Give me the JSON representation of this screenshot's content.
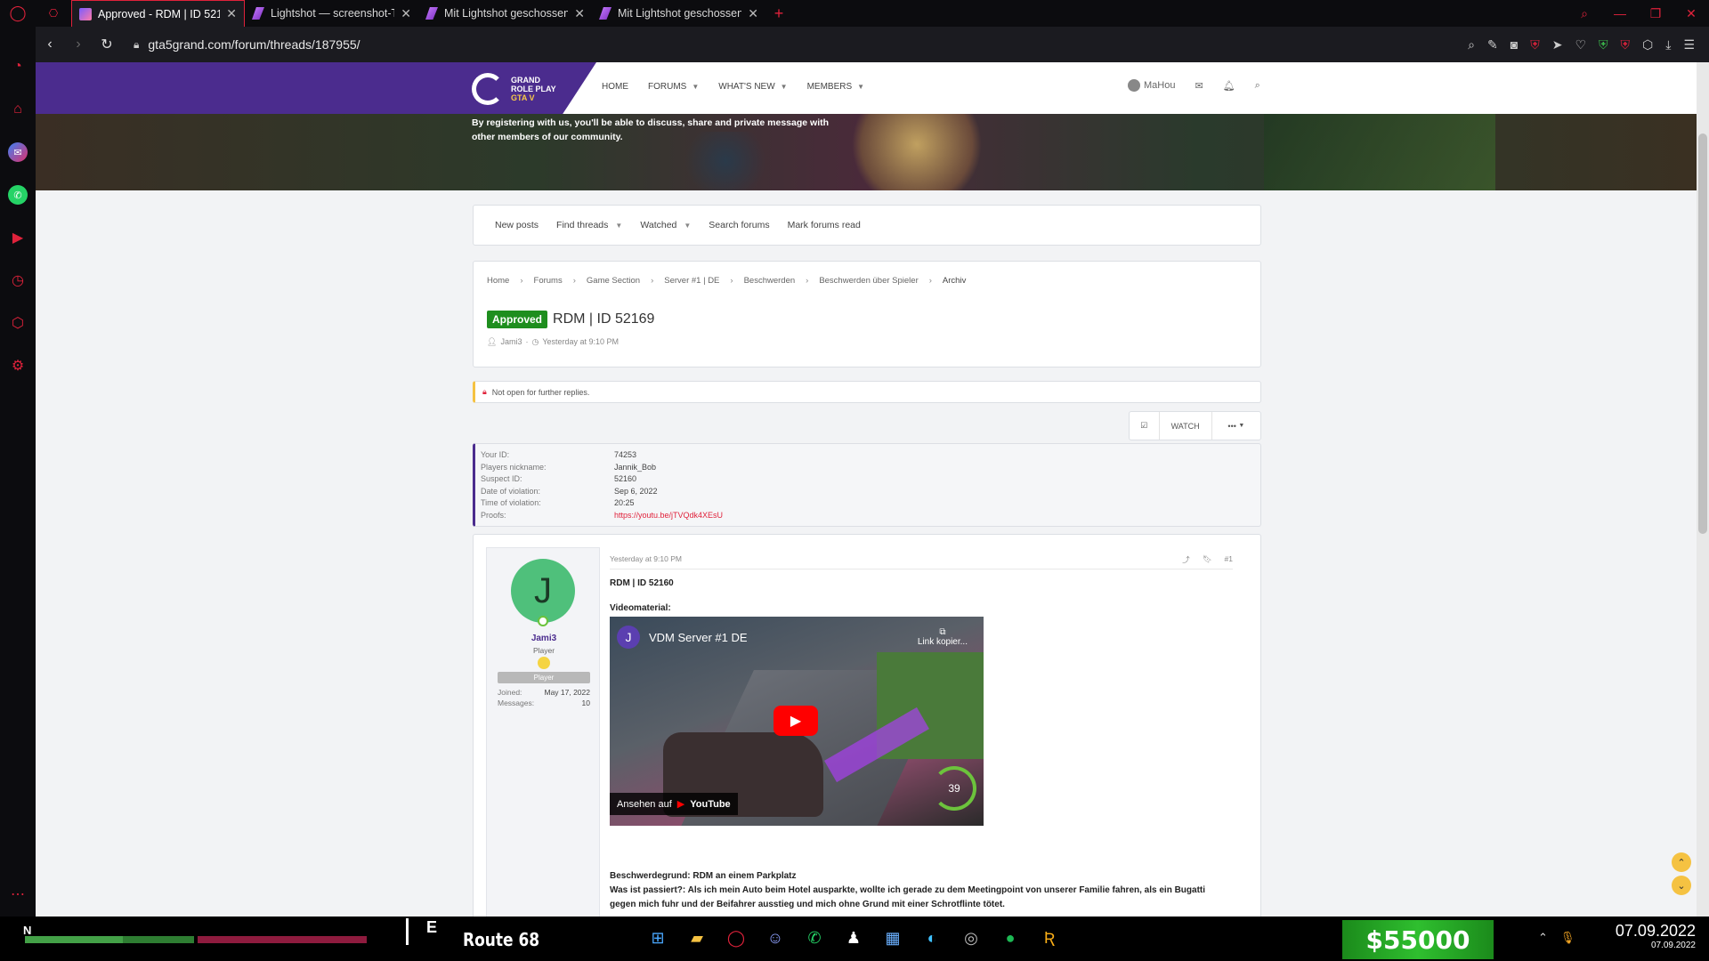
{
  "browser": {
    "tabs": [
      {
        "label": "Approved - RDM | ID 52169",
        "active": true
      },
      {
        "label": "Lightshot — screenshot-To",
        "active": false
      },
      {
        "label": "Mit Lightshot geschossen",
        "active": false
      },
      {
        "label": "Mit Lightshot geschossen",
        "active": false
      }
    ],
    "new_tab": "+",
    "url": "gta5grand.com/forum/threads/187955/"
  },
  "site": {
    "logo": {
      "line1": "GRAND",
      "line2": "ROLE PLAY",
      "line3": "GTA V"
    },
    "nav": [
      {
        "label": "HOME",
        "caret": false
      },
      {
        "label": "FORUMS",
        "caret": true
      },
      {
        "label": "WHAT'S NEW",
        "caret": true
      },
      {
        "label": "MEMBERS",
        "caret": true
      }
    ],
    "user": "MaHou",
    "banner_text": "By registering with us, you'll be able to discuss, share and private message with other members of our community."
  },
  "subnav": [
    {
      "label": "New posts",
      "caret": false
    },
    {
      "label": "Find threads",
      "caret": true
    },
    {
      "label": "Watched",
      "caret": true
    },
    {
      "label": "Search forums",
      "caret": false
    },
    {
      "label": "Mark forums read",
      "caret": false
    }
  ],
  "breadcrumbs": [
    "Home",
    "Forums",
    "Game Section",
    "Server #1 | DE",
    "Beschwerden",
    "Beschwerden über Spieler",
    "Archiv"
  ],
  "thread": {
    "badge": "Approved",
    "title": "RDM | ID 52169",
    "author": "Jami3",
    "date": "Yesterday at 9:10 PM",
    "notice": "Not open for further replies.",
    "watch_label": "WATCH",
    "more_label": "•••"
  },
  "info": [
    {
      "key": "Your ID:",
      "value": "74253"
    },
    {
      "key": "Players nickname:",
      "value": "Jannik_Bob"
    },
    {
      "key": "Suspect ID:",
      "value": "52160"
    },
    {
      "key": "Date of violation:",
      "value": "Sep 6, 2022"
    },
    {
      "key": "Time of violation:",
      "value": "20:25"
    },
    {
      "key": "Proofs:",
      "value": "https://youtu.be/jTVQdk4XEsU"
    }
  ],
  "post": {
    "user": {
      "initial": "J",
      "name": "Jami3",
      "title": "Player",
      "banner": "Player",
      "joined_label": "Joined:",
      "joined": "May 17, 2022",
      "messages_label": "Messages:",
      "messages": "10"
    },
    "date": "Yesterday at 9:10 PM",
    "number": "#1",
    "heading": "RDM | ID 52160",
    "video_label": "Videomaterial:",
    "video": {
      "channel_initial": "J",
      "title": "VDM Server #1 DE",
      "copy": "Link kopier...",
      "watch_on": "Ansehen auf",
      "youtube": "YouTube",
      "speed": "39"
    },
    "text": [
      "Beschwerdegrund: RDM an einem Parkplatz",
      "Was ist passiert?: Als ich mein Auto beim Hotel ausparkte, wollte ich gerade zu dem Meetingpoint von unserer Familie fahren, als ein Bugatti",
      "gegen mich fuhr und der Beifahrer ausstieg und mich ohne Grund mit einer Schrotflinte tötet."
    ]
  },
  "hud": {
    "compass": "N",
    "heading": "E",
    "street": "Route 68",
    "money": "$55000",
    "health_fraction": 0.58,
    "date_big": "07.09.2022",
    "date_small": "07.09.2022"
  },
  "colors": {
    "accent": "#e0223b",
    "brand_purple": "#4b2c8e",
    "approved": "#1e8e1e",
    "money": "#2fbf2f"
  }
}
